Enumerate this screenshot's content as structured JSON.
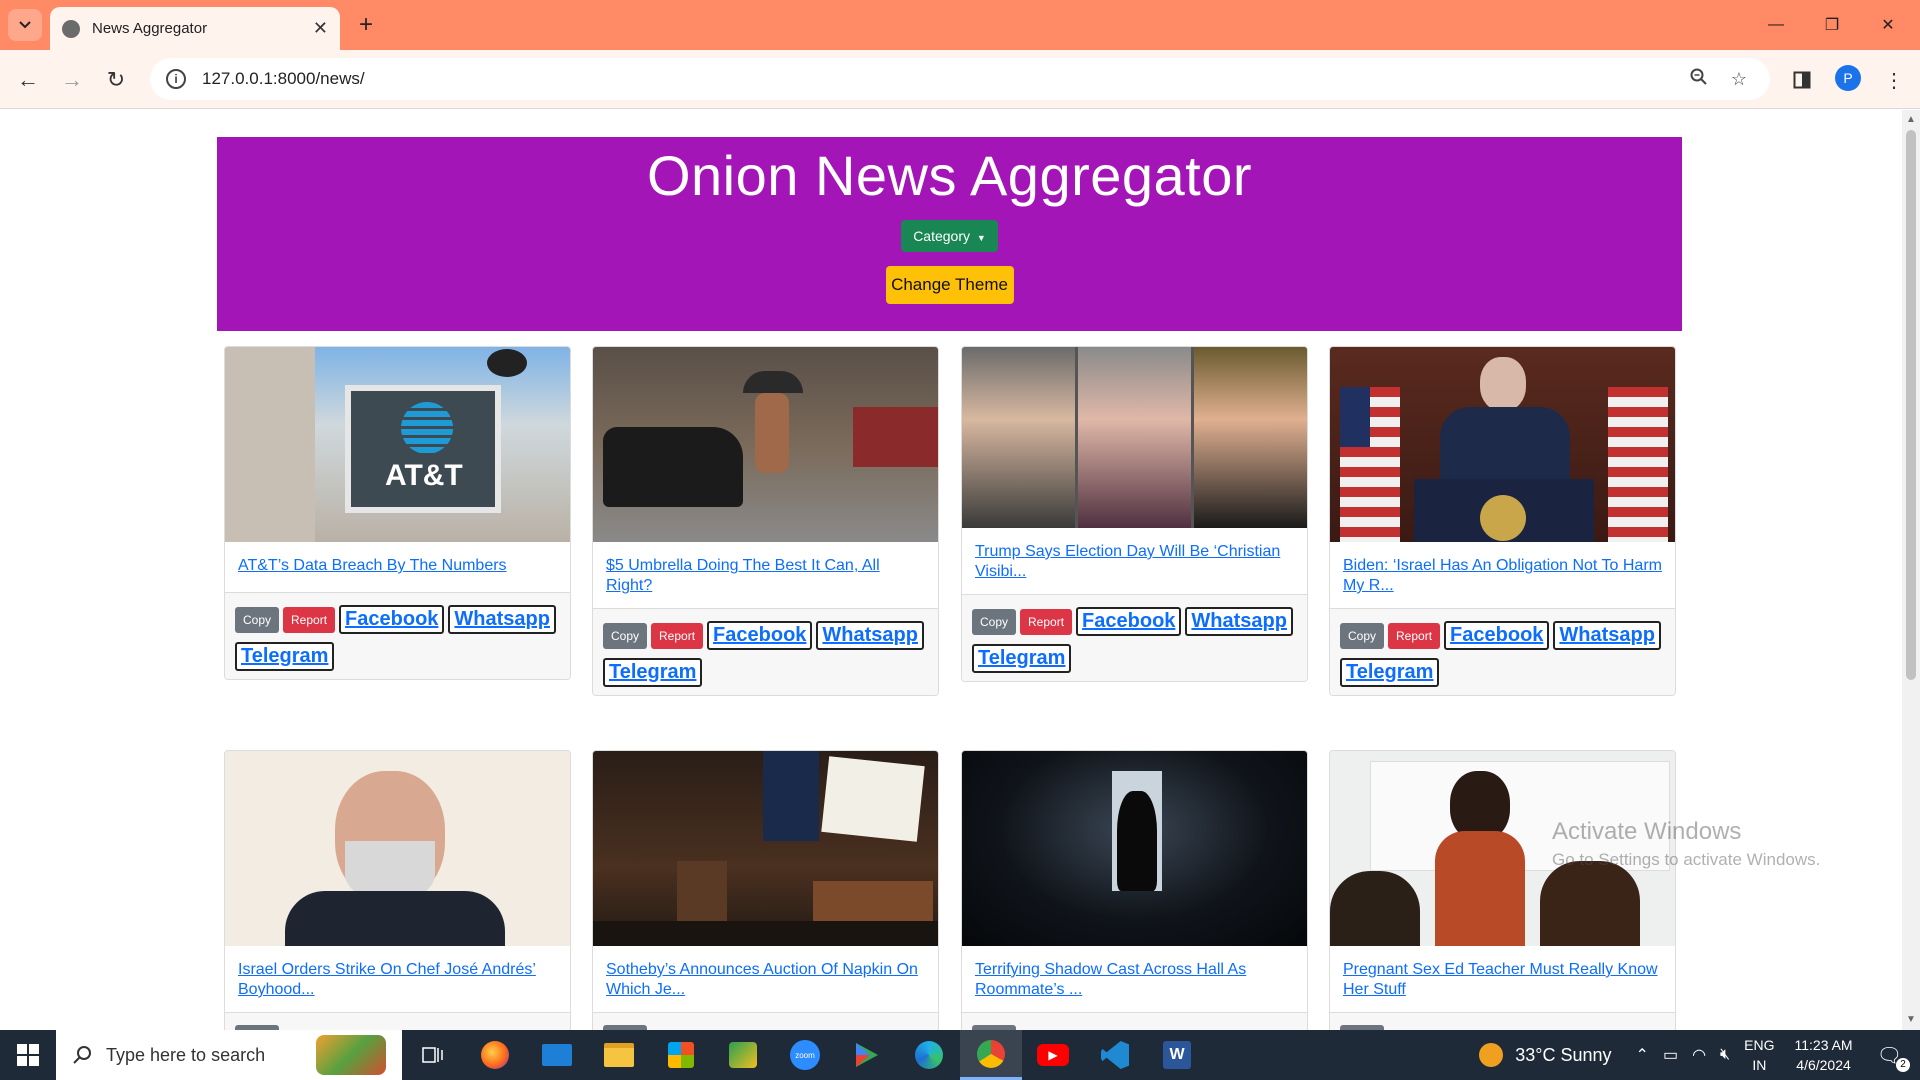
{
  "browser": {
    "tab_title": "News Aggregator",
    "url": "127.0.0.1:8000/news/",
    "profile_initial": "P",
    "accent_color": "#ff8a65"
  },
  "page": {
    "site_title": "Onion News Aggregator",
    "category_label": "Category",
    "theme_label": "Change Theme",
    "header_color": "#a315b7"
  },
  "buttons": {
    "copy": "Copy",
    "report": "Report",
    "facebook": "Facebook",
    "whatsapp": "Whatsapp",
    "telegram": "Telegram"
  },
  "articles": [
    {
      "title": "AT&T’s Data Breach By The Numbers",
      "image": "att-sign"
    },
    {
      "title": "$5 Umbrella Doing The Best It Can, All Right?",
      "image": "rainy-street"
    },
    {
      "title": "Trump Says Election Day Will Be ‘Christian Visibi...",
      "image": "three-portraits"
    },
    {
      "title": "Biden: ‘Israel Has An Obligation Not To Harm My R...",
      "image": "president-podium"
    },
    {
      "title": "Israel Orders Strike On Chef José Andrés’ Boyhood...",
      "image": "chef-portrait"
    },
    {
      "title": "Sotheby’s Announces Auction Of Napkin On Which Je...",
      "image": "auction-room"
    },
    {
      "title": "Terrifying Shadow Cast Across Hall As Roommate’s ...",
      "image": "dark-hallway"
    },
    {
      "title": "Pregnant Sex Ed Teacher Must Really Know Her Stuff",
      "image": "classroom-teacher"
    }
  ],
  "watermark": {
    "line1": "Activate Windows",
    "line2": "Go to Settings to activate Windows."
  },
  "taskbar": {
    "search_placeholder": "Type here to search",
    "weather": "33°C  Sunny",
    "lang_line1": "ENG",
    "lang_line2": "IN",
    "time": "11:23 AM",
    "date": "4/6/2024",
    "notification_count": "2"
  }
}
